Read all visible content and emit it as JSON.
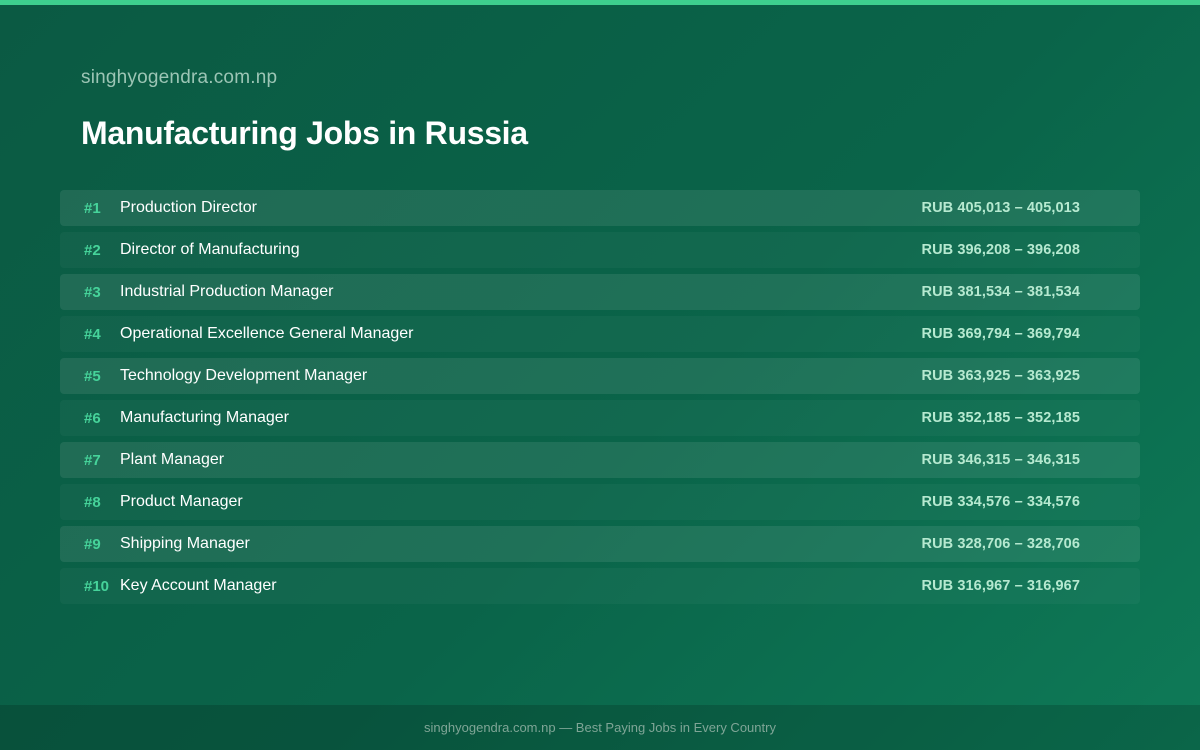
{
  "header": {
    "site_name": "singhyogendra.com.np",
    "title": "Manufacturing Jobs in Russia"
  },
  "jobs": [
    {
      "rank": "#1",
      "title": "Production Director",
      "salary": "RUB 405,013 – 405,013"
    },
    {
      "rank": "#2",
      "title": "Director of Manufacturing",
      "salary": "RUB 396,208 – 396,208"
    },
    {
      "rank": "#3",
      "title": "Industrial Production Manager",
      "salary": "RUB 381,534 – 381,534"
    },
    {
      "rank": "#4",
      "title": "Operational Excellence General Manager",
      "salary": "RUB 369,794 – 369,794"
    },
    {
      "rank": "#5",
      "title": "Technology Development Manager",
      "salary": "RUB 363,925 – 363,925"
    },
    {
      "rank": "#6",
      "title": "Manufacturing Manager",
      "salary": "RUB 352,185 – 352,185"
    },
    {
      "rank": "#7",
      "title": "Plant Manager",
      "salary": "RUB 346,315 – 346,315"
    },
    {
      "rank": "#8",
      "title": "Product Manager",
      "salary": "RUB 334,576 – 334,576"
    },
    {
      "rank": "#9",
      "title": "Shipping Manager",
      "salary": "RUB 328,706 – 328,706"
    },
    {
      "rank": "#10",
      "title": "Key Account Manager",
      "salary": "RUB 316,967 – 316,967"
    }
  ],
  "footer": {
    "text": "singhyogendra.com.np — Best Paying Jobs in Every Country"
  },
  "colors": {
    "accent": "#3ecf8e",
    "rank": "#46d39a",
    "background": "#0a6449"
  }
}
